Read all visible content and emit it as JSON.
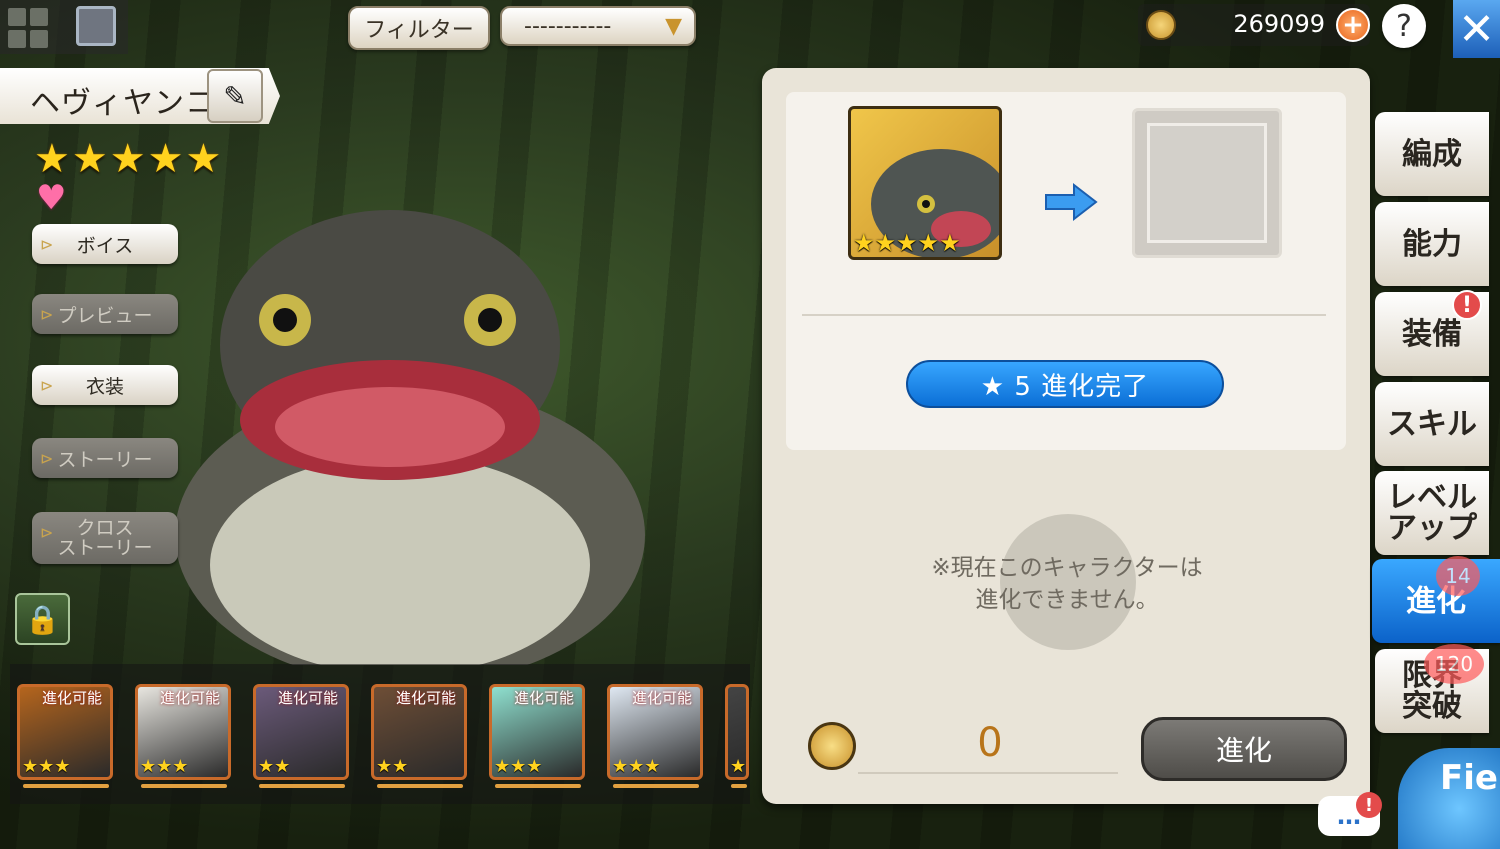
{
  "top": {
    "filter_label": "フィルター",
    "sort_value": "-----------",
    "coins": "269099",
    "plus": "+",
    "help": "?",
    "close": "✕"
  },
  "character": {
    "name": "ヘヴィヤンコ",
    "stars": "★★★★★",
    "rarity": 5,
    "favorite": "♥"
  },
  "side_menu": [
    {
      "label": "ボイス",
      "enabled": true
    },
    {
      "label": "プレビュー",
      "enabled": false
    },
    {
      "label": "衣装",
      "enabled": true
    },
    {
      "label": "ストーリー",
      "enabled": false
    },
    {
      "label": "クロス\nストーリー",
      "enabled": false
    }
  ],
  "roster": [
    {
      "label": "進化可能",
      "stars": "★★★",
      "color": "#b5651d"
    },
    {
      "label": "進化可能",
      "stars": "★★★",
      "color": "#e8e6e0"
    },
    {
      "label": "進化可能",
      "stars": "★★",
      "color": "#6b5a7a"
    },
    {
      "label": "進化可能",
      "stars": "★★",
      "color": "#6e4e36"
    },
    {
      "label": "進化可能",
      "stars": "★★★",
      "color": "#8fe0cf"
    },
    {
      "label": "進化可能",
      "stars": "★★★",
      "color": "#dfe8f2"
    },
    {
      "label": "",
      "stars": "★★",
      "color": "#444"
    }
  ],
  "evolution": {
    "portrait_stars": "★★★★★",
    "complete_label": "★ 5 進化完了",
    "message_line1": "※現在このキャラクターは",
    "message_line2": "進化できません。",
    "cost": "0",
    "evolve_button": "進化"
  },
  "tabs": [
    {
      "label": "編成",
      "active": false
    },
    {
      "label": "能力",
      "active": false
    },
    {
      "label": "装備",
      "active": false
    },
    {
      "label": "スキル",
      "active": false
    },
    {
      "label": "レベル\nアップ",
      "active": false
    },
    {
      "label": "進化",
      "active": true
    },
    {
      "label": "限界\n突破",
      "active": false
    }
  ],
  "badges": {
    "evolve_count": "14",
    "limit_count": "120",
    "equip_alert": "!",
    "chat_alert": "!"
  },
  "chat": "…",
  "field_label": "Fie",
  "colors": {
    "accent_blue": "#0b6fd6",
    "gold": "#ffd21e",
    "panel": "#e9e4d8"
  }
}
